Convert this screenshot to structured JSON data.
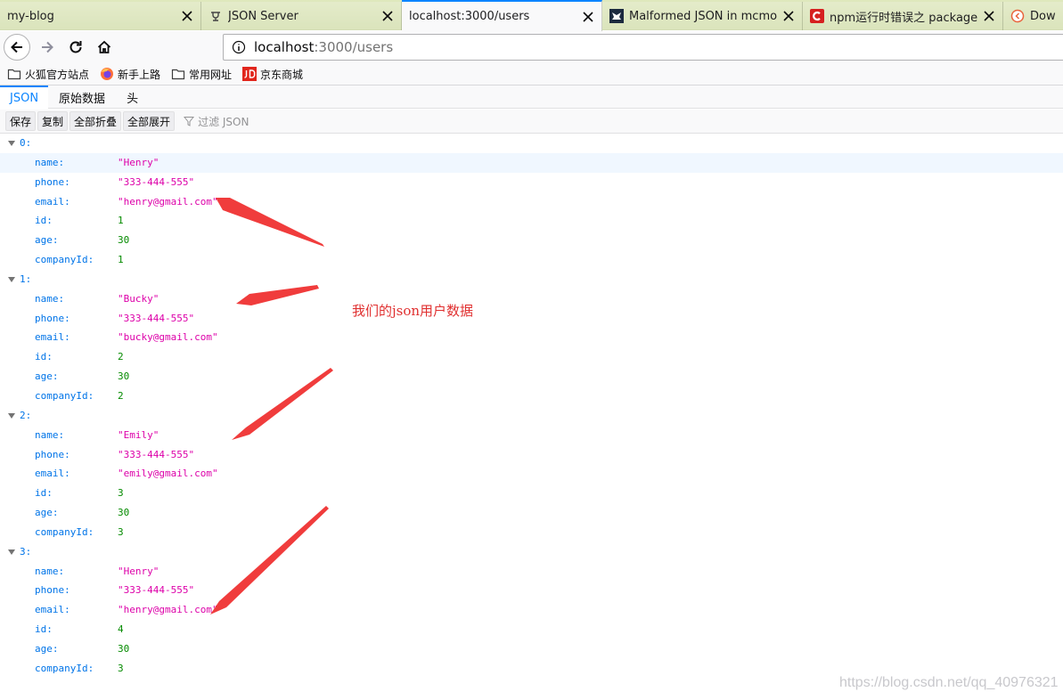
{
  "browser": {
    "tabs": [
      {
        "title": "my-blog",
        "favicon": "none"
      },
      {
        "title": "JSON Server",
        "favicon": "json-server-icon"
      },
      {
        "title": "localhost:3000/users",
        "favicon": "none",
        "active": true
      },
      {
        "title": "Malformed JSON in mcmod.",
        "favicon": "curseforge-icon"
      },
      {
        "title": "npm运行时错误之 package.js",
        "favicon": "csdn-icon"
      },
      {
        "title": "Downl",
        "favicon": "download-icon"
      }
    ],
    "url": {
      "host": "localhost",
      "path": ":3000/users"
    },
    "bookmarks": [
      {
        "label": "火狐官方站点",
        "icon": "folder-icon"
      },
      {
        "label": "新手上路",
        "icon": "firefox-icon"
      },
      {
        "label": "常用网址",
        "icon": "folder-icon"
      },
      {
        "label": "京东商城",
        "icon": "jd-icon"
      }
    ]
  },
  "viewer": {
    "tabs": [
      "JSON",
      "原始数据",
      "头"
    ],
    "toolbar": {
      "save": "保存",
      "copy": "复制",
      "collapse_all": "全部折叠",
      "expand_all": "全部展开",
      "filter_placeholder": "过滤 JSON"
    }
  },
  "users": [
    {
      "index": "0:",
      "fields": [
        [
          "name:",
          "\"Henry\"",
          "str"
        ],
        [
          "phone:",
          "\"333-444-555\"",
          "str"
        ],
        [
          "email:",
          "\"henry@gmail.com\"",
          "str"
        ],
        [
          "id:",
          "1",
          "num"
        ],
        [
          "age:",
          "30",
          "num"
        ],
        [
          "companyId:",
          "1",
          "num"
        ]
      ]
    },
    {
      "index": "1:",
      "fields": [
        [
          "name:",
          "\"Bucky\"",
          "str"
        ],
        [
          "phone:",
          "\"333-444-555\"",
          "str"
        ],
        [
          "email:",
          "\"bucky@gmail.com\"",
          "str"
        ],
        [
          "id:",
          "2",
          "num"
        ],
        [
          "age:",
          "30",
          "num"
        ],
        [
          "companyId:",
          "2",
          "num"
        ]
      ]
    },
    {
      "index": "2:",
      "fields": [
        [
          "name:",
          "\"Emily\"",
          "str"
        ],
        [
          "phone:",
          "\"333-444-555\"",
          "str"
        ],
        [
          "email:",
          "\"emily@gmail.com\"",
          "str"
        ],
        [
          "id:",
          "3",
          "num"
        ],
        [
          "age:",
          "30",
          "num"
        ],
        [
          "companyId:",
          "3",
          "num"
        ]
      ]
    },
    {
      "index": "3:",
      "fields": [
        [
          "name:",
          "\"Henry\"",
          "str"
        ],
        [
          "phone:",
          "\"333-444-555\"",
          "str"
        ],
        [
          "email:",
          "\"henry@gmail.com\"",
          "str"
        ],
        [
          "id:",
          "4",
          "num"
        ],
        [
          "age:",
          "30",
          "num"
        ],
        [
          "companyId:",
          "3",
          "num"
        ]
      ]
    }
  ],
  "annotation": "我们的json用户数据",
  "watermark": "https://blog.csdn.net/qq_40976321",
  "colors": {
    "accent": "#0a84ff",
    "json_key": "#0074e8",
    "json_string": "#dd00a9",
    "json_number": "#058b00",
    "annotation": "#e03030"
  }
}
